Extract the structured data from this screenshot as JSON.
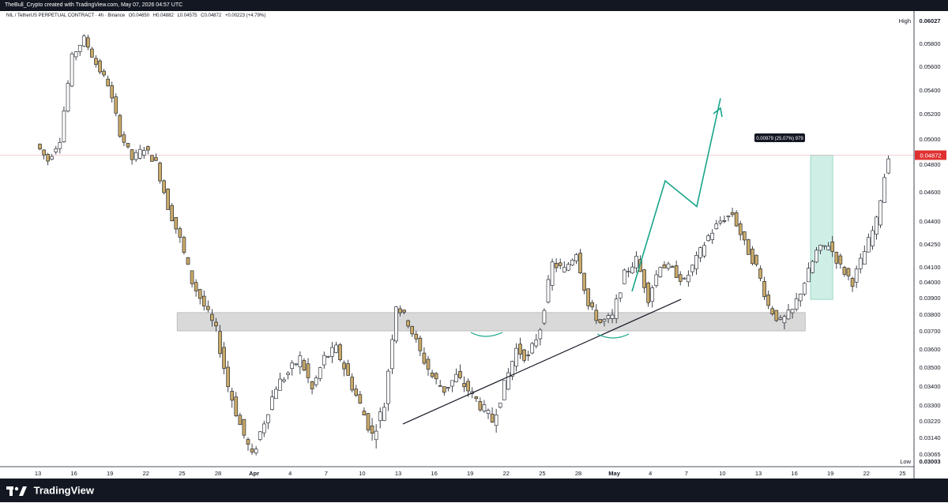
{
  "header": {
    "author_line": "TheBull_Crypto created with TradingView.com, May 07, 2026 04:57 UTC"
  },
  "symbol_line": {
    "symbol": "NIL / TetherUS PERPETUAL CONTRACT · 4h · Binance",
    "open": "O0.04650",
    "high": "H0.04882",
    "low": "L0.04575",
    "close": "C0.04872",
    "change": "+0.00223 (+4.79%)"
  },
  "footer": {
    "brand": "TradingView"
  },
  "colors": {
    "candle": "#c8a968",
    "wick": "#131722",
    "zone": "#d9d9d9",
    "projection": "#17a589",
    "trendline": "#131722",
    "price_tag": "#e03131",
    "measure_fill": "#cfeee6"
  },
  "chart_data": {
    "type": "candlestick",
    "price_scale": {
      "tick_labels": [
        "0.05800",
        "0.05600",
        "0.05400",
        "0.05200",
        "0.05000",
        "0.04800",
        "0.04600",
        "0.04400",
        "0.04250",
        "0.04100",
        "0.04000",
        "0.03900",
        "0.03800",
        "0.03700",
        "0.03600",
        "0.03500",
        "0.03400",
        "0.03300",
        "0.03220",
        "0.03140",
        "0.03065"
      ],
      "high_label": "High",
      "high_value": "0.06027",
      "low_label": "Low",
      "low_value": "0.03003",
      "last_price": "0.04872"
    },
    "time_scale": {
      "tick_labels": [
        "13",
        "16",
        "19",
        "22",
        "25",
        "28",
        "Apr",
        "4",
        "7",
        "10",
        "13",
        "16",
        "19",
        "22",
        "25",
        "28",
        "May",
        "4",
        "7",
        "10",
        "13",
        "16",
        "19",
        "22",
        "25"
      ]
    },
    "measure_label": "0.00979 (25.07%) 979",
    "zone": {
      "low": 0.037,
      "high": 0.0381
    },
    "trendline": [
      {
        "x": 12.8,
        "y": 0.03205
      },
      {
        "x": 38.7,
        "y": 0.0389
      }
    ],
    "projection_path": [
      {
        "x": 34.8,
        "y": 0.0394
      },
      {
        "x": 36.2,
        "y": 0.0468
      },
      {
        "x": 37.2,
        "y": 0.045
      },
      {
        "x": 38.8,
        "y": 0.0533
      }
    ],
    "projection_arrows": [
      {
        "from": {
          "x": 17.7,
          "y": 0.03685
        },
        "to": {
          "x": 19.7,
          "y": 0.03685
        }
      },
      {
        "from": {
          "x": 27.8,
          "y": 0.0367
        },
        "to": {
          "x": 29.8,
          "y": 0.0367
        }
      }
    ],
    "measure": {
      "x1": 42.9,
      "x2": 44.6,
      "y1": 0.0389,
      "y2": 0.04872
    },
    "x_ticks_index": [
      0,
      3,
      6,
      9,
      12,
      15,
      18,
      21,
      24,
      27,
      30,
      33,
      36,
      39,
      42,
      45,
      48,
      51,
      54,
      57,
      60,
      63,
      66,
      69,
      72
    ],
    "candles_anchor_path": [
      [
        0,
        0.0496
      ],
      [
        1,
        0.0483
      ],
      [
        2,
        0.05
      ],
      [
        3,
        0.0568
      ],
      [
        4,
        0.0585
      ],
      [
        5,
        0.0562
      ],
      [
        6,
        0.0545
      ],
      [
        7,
        0.0505
      ],
      [
        8,
        0.0484
      ],
      [
        9,
        0.0493
      ],
      [
        10,
        0.0481
      ],
      [
        11,
        0.045
      ],
      [
        12,
        0.0428
      ],
      [
        13,
        0.04
      ],
      [
        14,
        0.0385
      ],
      [
        15,
        0.037
      ],
      [
        16,
        0.034
      ],
      [
        17,
        0.032
      ],
      [
        18,
        0.0305
      ],
      [
        19,
        0.0322
      ],
      [
        20,
        0.034
      ],
      [
        21,
        0.0347
      ],
      [
        22,
        0.0355
      ],
      [
        23,
        0.0338
      ],
      [
        24,
        0.0355
      ],
      [
        25,
        0.036
      ],
      [
        26,
        0.0345
      ],
      [
        27,
        0.033
      ],
      [
        28,
        0.0315
      ],
      [
        29,
        0.033
      ],
      [
        30,
        0.0386
      ],
      [
        31,
        0.0375
      ],
      [
        32,
        0.0358
      ],
      [
        33,
        0.0345
      ],
      [
        34,
        0.0338
      ],
      [
        35,
        0.0345
      ],
      [
        36,
        0.0338
      ],
      [
        37,
        0.033
      ],
      [
        38,
        0.0322
      ],
      [
        39,
        0.034
      ],
      [
        40,
        0.036
      ],
      [
        41,
        0.0355
      ],
      [
        42,
        0.0372
      ],
      [
        43,
        0.0412
      ],
      [
        44,
        0.0408
      ],
      [
        45,
        0.042
      ],
      [
        46,
        0.0385
      ],
      [
        47,
        0.0375
      ],
      [
        48,
        0.0378
      ],
      [
        49,
        0.0405
      ],
      [
        50,
        0.0415
      ],
      [
        51,
        0.039
      ],
      [
        52,
        0.0412
      ],
      [
        53,
        0.0408
      ],
      [
        54,
        0.04
      ],
      [
        55,
        0.0415
      ],
      [
        56,
        0.043
      ],
      [
        57,
        0.044
      ],
      [
        58,
        0.0445
      ],
      [
        59,
        0.0425
      ],
      [
        60,
        0.041
      ],
      [
        61,
        0.0385
      ],
      [
        62,
        0.0375
      ],
      [
        63,
        0.0382
      ],
      [
        64,
        0.04
      ],
      [
        65,
        0.042
      ],
      [
        66,
        0.0425
      ],
      [
        67,
        0.041
      ],
      [
        68,
        0.04
      ],
      [
        69,
        0.042
      ],
      [
        70,
        0.044
      ],
      [
        71,
        0.0487
      ]
    ]
  }
}
